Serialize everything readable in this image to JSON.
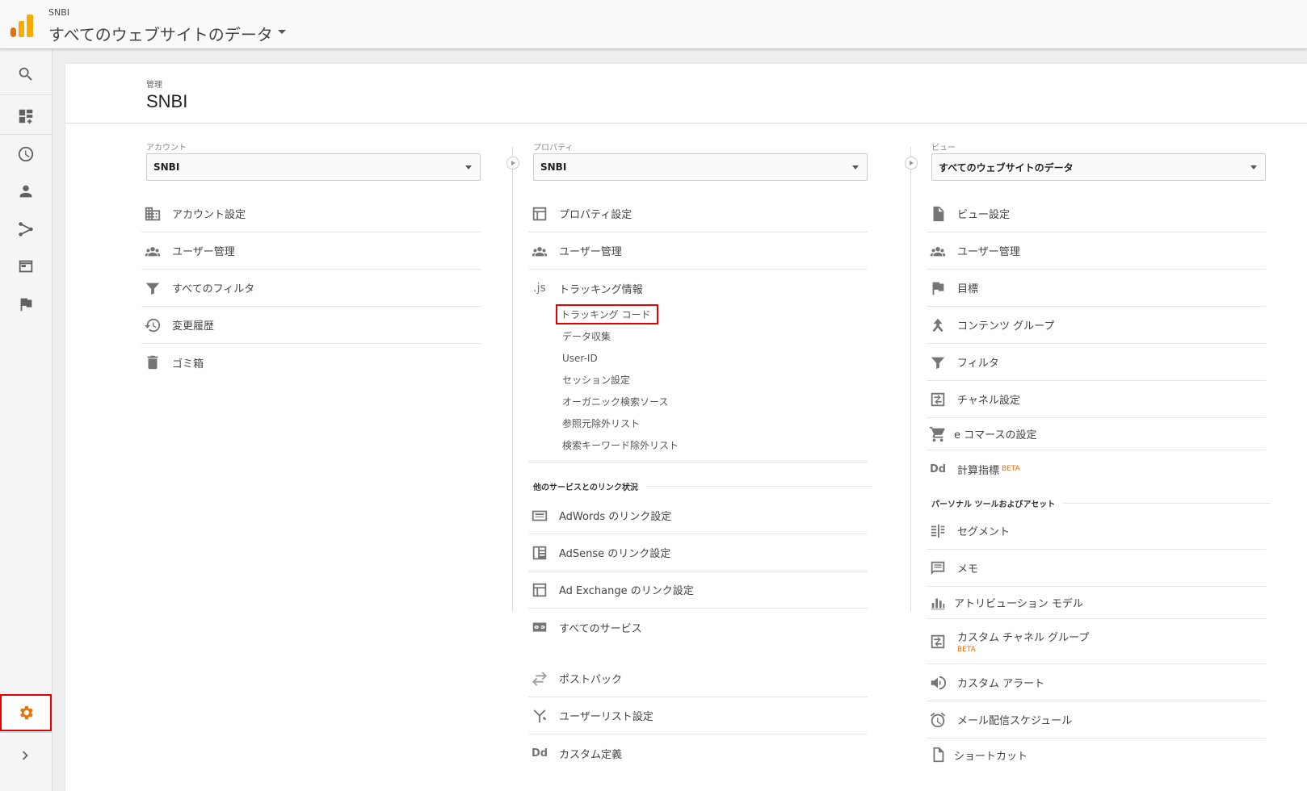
{
  "topbar": {
    "account": "SNBI",
    "view": "すべてのウェブサイトのデータ"
  },
  "header": {
    "breadcrumb": "管理",
    "title": "SNBI"
  },
  "account_col": {
    "label": "アカウント",
    "selected": "SNBI",
    "items": [
      {
        "icon": "building-icon",
        "label": "アカウント設定"
      },
      {
        "icon": "users-icon",
        "label": "ユーザー管理"
      },
      {
        "icon": "filter-icon",
        "label": "すべてのフィルタ"
      },
      {
        "icon": "history-icon",
        "label": "変更履歴"
      },
      {
        "icon": "trash-icon",
        "label": "ゴミ箱"
      }
    ]
  },
  "property_col": {
    "label": "プロパティ",
    "selected": "SNBI",
    "items": [
      {
        "icon": "property-settings-icon",
        "label": "プロパティ設定"
      },
      {
        "icon": "users-icon",
        "label": "ユーザー管理"
      },
      {
        "icon": "js-icon",
        "label": "トラッキング情報"
      }
    ],
    "tracking_subitems": [
      "トラッキング コード",
      "データ収集",
      "User-ID",
      "セッション設定",
      "オーガニック検索ソース",
      "参照元除外リスト",
      "検索キーワード除外リスト"
    ],
    "link_section": "他のサービスとのリンク状況",
    "link_items": [
      {
        "icon": "adwords-icon",
        "label": "AdWords のリンク設定"
      },
      {
        "icon": "adsense-icon",
        "label": "AdSense のリンク設定"
      },
      {
        "icon": "ad-exchange-icon",
        "label": "Ad Exchange のリンク設定"
      },
      {
        "icon": "link-icon",
        "label": "すべてのサービス"
      }
    ],
    "extra_items": [
      {
        "icon": "postback-icon",
        "label": "ポストバック"
      },
      {
        "icon": "user-list-icon",
        "label": "ユーザーリスト設定"
      },
      {
        "icon": "dd-icon",
        "label": "カスタム定義"
      }
    ]
  },
  "view_col": {
    "label": "ビュー",
    "selected": "すべてのウェブサイトのデータ",
    "items": [
      {
        "icon": "document-icon",
        "label": "ビュー設定"
      },
      {
        "icon": "users-icon",
        "label": "ユーザー管理"
      },
      {
        "icon": "flag-icon",
        "label": "目標"
      },
      {
        "icon": "content-group-icon",
        "label": "コンテンツ グループ"
      },
      {
        "icon": "filter-icon",
        "label": "フィルタ"
      },
      {
        "icon": "channel-icon",
        "label": "チャネル設定"
      },
      {
        "icon": "cart-icon",
        "label": "e コマースの設定"
      },
      {
        "icon": "dd-icon",
        "label": "計算指標",
        "badge": "BETA"
      }
    ],
    "personal_section": "パーソナル ツールおよびアセット",
    "personal_items": [
      {
        "icon": "segment-icon",
        "label": "セグメント"
      },
      {
        "icon": "comment-icon",
        "label": "メモ"
      },
      {
        "icon": "bar-chart-icon",
        "label": "アトリビューション モデル"
      },
      {
        "icon": "channel-icon",
        "label": "カスタム チャネル グループ",
        "badge": "BETA"
      },
      {
        "icon": "megaphone-icon",
        "label": "カスタム アラート"
      },
      {
        "icon": "alarm-icon",
        "label": "メール配信スケジュール"
      },
      {
        "icon": "file-icon",
        "label": "ショートカット"
      }
    ]
  },
  "js_text": ".js",
  "dd_text": "Dd"
}
